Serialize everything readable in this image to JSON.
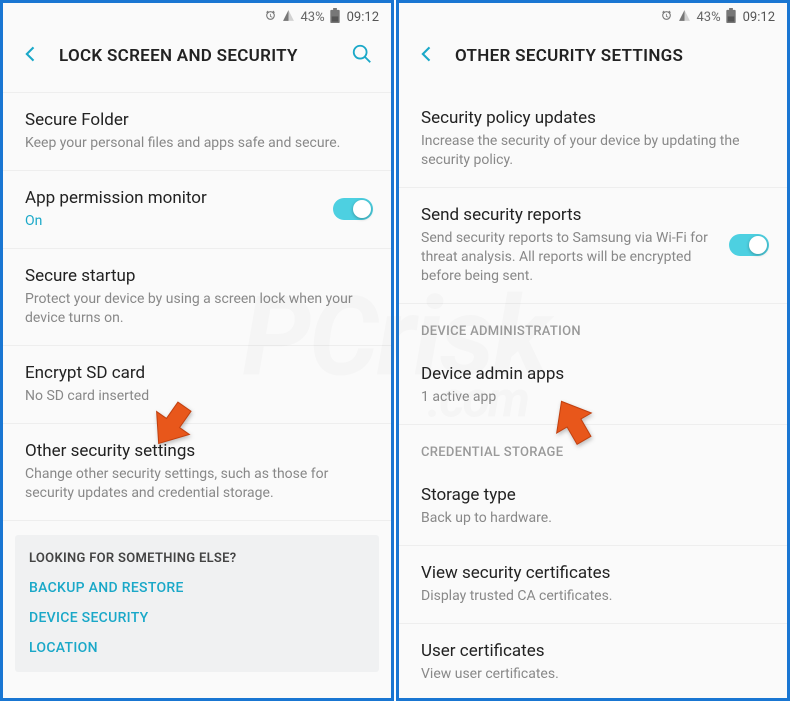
{
  "status": {
    "battery_pct": "43%",
    "time": "09:12"
  },
  "left": {
    "title": "LOCK SCREEN AND SECURITY",
    "items": {
      "secure_folder": {
        "title": "Secure Folder",
        "sub": "Keep your personal files and apps safe and secure."
      },
      "app_perm": {
        "title": "App permission monitor",
        "sub": "On"
      },
      "secure_startup": {
        "title": "Secure startup",
        "sub": "Protect your device by using a screen lock when your device turns on."
      },
      "encrypt_sd": {
        "title": "Encrypt SD card",
        "sub": "No SD card inserted"
      },
      "other_sec": {
        "title": "Other security settings",
        "sub": "Change other security settings, such as those for security updates and credential storage."
      }
    },
    "helper": {
      "title": "LOOKING FOR SOMETHING ELSE?",
      "links": [
        "BACKUP AND RESTORE",
        "DEVICE SECURITY",
        "LOCATION"
      ]
    }
  },
  "right": {
    "title": "OTHER SECURITY SETTINGS",
    "items": {
      "policy": {
        "title": "Security policy updates",
        "sub": "Increase the security of your device by updating the security policy."
      },
      "reports": {
        "title": "Send security reports",
        "sub": "Send security reports to Samsung via Wi-Fi for threat analysis. All reports will be encrypted before being sent."
      },
      "admin": {
        "title": "Device admin apps",
        "sub": "1 active app"
      },
      "storage": {
        "title": "Storage type",
        "sub": "Back up to hardware."
      },
      "view_certs": {
        "title": "View security certificates",
        "sub": "Display trusted CA certificates."
      },
      "user_certs": {
        "title": "User certificates",
        "sub": "View user certificates."
      }
    },
    "section_device_admin": "DEVICE ADMINISTRATION",
    "section_cred": "CREDENTIAL STORAGE"
  },
  "watermark": {
    "main": "PCrisk",
    "sub": ".com"
  }
}
